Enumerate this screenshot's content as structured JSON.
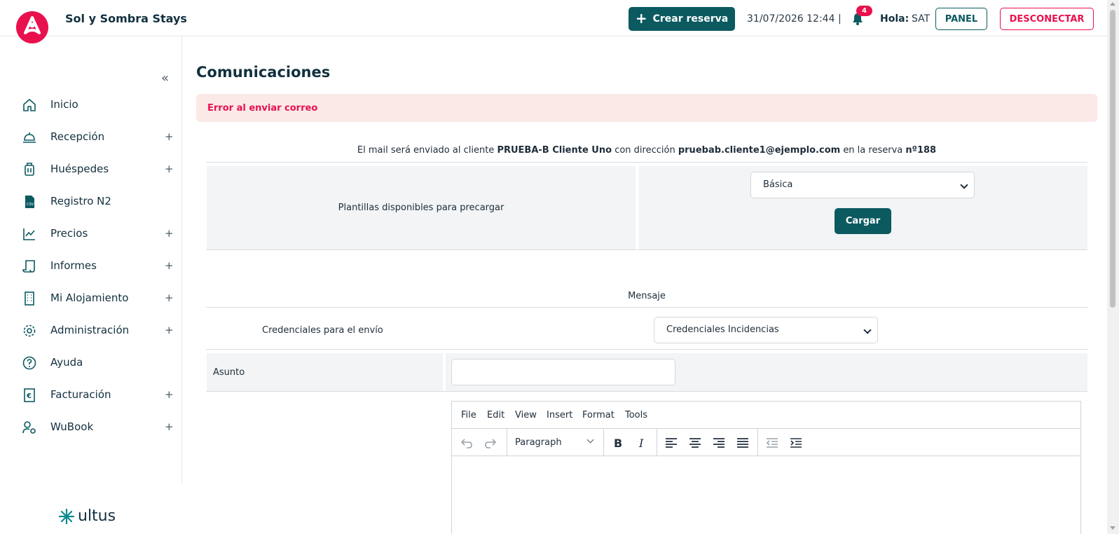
{
  "header": {
    "brand": "Sol y Sombra Stays",
    "create_label": "Crear reserva",
    "datetime": "31/07/2026 12:44 |",
    "notifications_count": "4",
    "greeting": "Hola:",
    "user": "SAT",
    "panel_label": "PANEL",
    "logout_label": "DESCONECTAR"
  },
  "sidebar": {
    "collapse_glyph": "«",
    "items": [
      {
        "label": "Inicio",
        "icon": "home-icon",
        "expandable": ""
      },
      {
        "label": "Recepción",
        "icon": "reception-bell-icon",
        "expandable": "+"
      },
      {
        "label": "Huéspedes",
        "icon": "luggage-icon",
        "expandable": "+"
      },
      {
        "label": "Registro N2",
        "icon": "csv-file-icon",
        "expandable": ""
      },
      {
        "label": "Precios",
        "icon": "chart-line-icon",
        "expandable": "+"
      },
      {
        "label": "Informes",
        "icon": "scroll-icon",
        "expandable": "+"
      },
      {
        "label": "Mi Alojamiento",
        "icon": "building-icon",
        "expandable": "+"
      },
      {
        "label": "Administración",
        "icon": "gear-icon",
        "expandable": "+"
      },
      {
        "label": "Ayuda",
        "icon": "help-circle-icon",
        "expandable": ""
      },
      {
        "label": "Facturación",
        "icon": "invoice-euro-icon",
        "expandable": "+"
      },
      {
        "label": "WuBook",
        "icon": "user-settings-icon",
        "expandable": "+"
      }
    ],
    "footer_brand": "ultus"
  },
  "main": {
    "title": "Comunicaciones",
    "alert": "Error al enviar correo",
    "mail_info": {
      "prefix": "El mail será enviado al cliente",
      "client": "PRUEBA-B Cliente Uno",
      "mid": "con dirección",
      "email": "pruebab.cliente1@ejemplo.com",
      "mid2": "en la reserva",
      "booking": "nº188"
    },
    "templates_label": "Plantillas disponibles para precargar",
    "template_selected": "Básica",
    "load_label": "Cargar",
    "message_heading": "Mensaje",
    "credentials_label": "Credenciales para el envío",
    "credentials_selected": "Credenciales Incidencias",
    "subject_label": "Asunto",
    "subject_value": ""
  },
  "editor": {
    "menu": [
      "File",
      "Edit",
      "View",
      "Insert",
      "Format",
      "Tools"
    ],
    "block_format": "Paragraph"
  },
  "colors": {
    "accent": "#0b5a60",
    "brand": "#e8114e",
    "alert_bg": "#fbe9e7"
  }
}
